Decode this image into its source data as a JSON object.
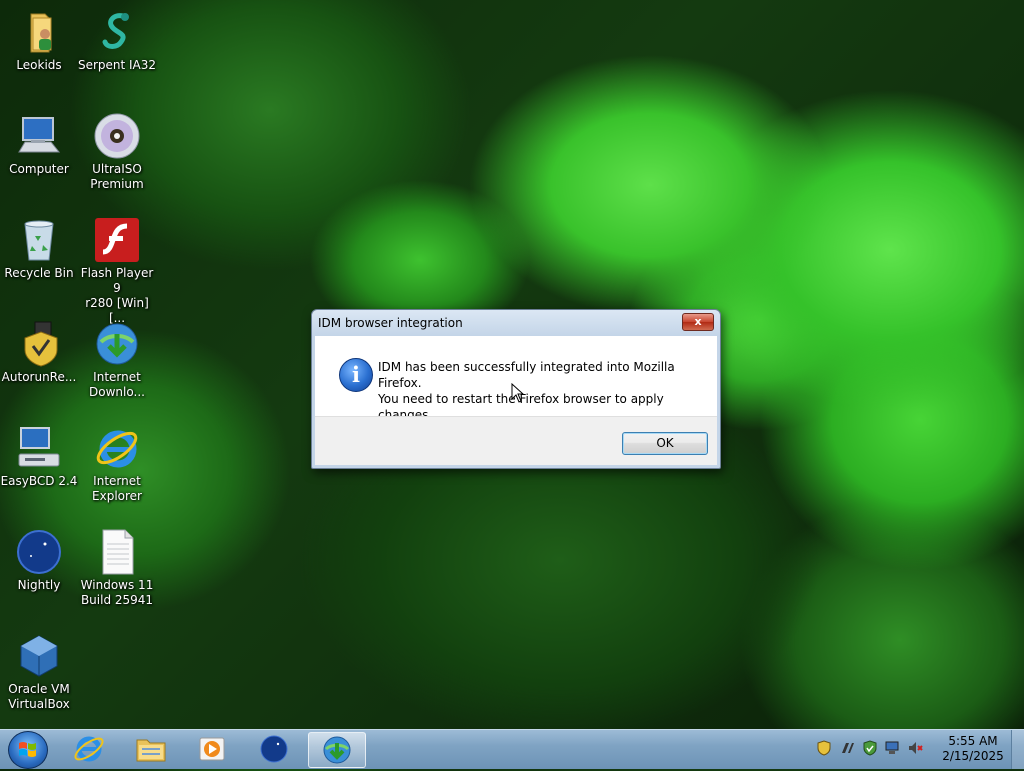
{
  "desktop": {
    "icons": [
      {
        "label": "Leokids",
        "icon": "folder-user-icon"
      },
      {
        "label": "Serpent IA32",
        "icon": "serpent-icon"
      },
      {
        "label": "Computer",
        "icon": "computer-icon"
      },
      {
        "label": "UltraISO\nPremium",
        "icon": "disc-icon"
      },
      {
        "label": "Recycle Bin",
        "icon": "recycle-bin-icon"
      },
      {
        "label": "Flash Player 9\nr280 [Win] [...",
        "icon": "flash-icon"
      },
      {
        "label": "AutorunRe...",
        "icon": "shield-usb-icon"
      },
      {
        "label": "Internet\nDownlo...",
        "icon": "idm-icon"
      },
      {
        "label": "EasyBCD 2.4",
        "icon": "easybcd-icon"
      },
      {
        "label": "Internet\nExplorer",
        "icon": "internet-explorer-icon"
      },
      {
        "label": "Nightly",
        "icon": "nightly-icon"
      },
      {
        "label": "Windows 11\nBuild 25941",
        "icon": "text-file-icon"
      },
      {
        "label": "Oracle VM\nVirtualBox",
        "icon": "virtualbox-icon"
      }
    ]
  },
  "dialog": {
    "title": "IDM browser integration",
    "close_label": "x",
    "message_line1": "IDM has been successfully integrated into Mozilla Firefox.",
    "message_line2": "You need to restart the Firefox browser to apply changes",
    "ok_label": "OK",
    "icon": "info-icon"
  },
  "taskbar": {
    "start_icon": "windows-start-icon",
    "pinned": [
      {
        "name": "internet-explorer-icon"
      },
      {
        "name": "file-explorer-icon"
      },
      {
        "name": "media-player-icon"
      },
      {
        "name": "nightly-icon"
      },
      {
        "name": "idm-icon",
        "active": true
      }
    ],
    "tray": [
      "shield-icon",
      "idm-tray-icon",
      "security-icon",
      "network-icon",
      "volume-muted-icon"
    ],
    "clock_time": "5:55 AM",
    "clock_date": "2/15/2025"
  }
}
